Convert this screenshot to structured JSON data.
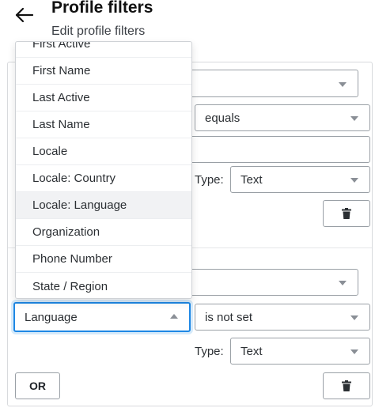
{
  "header": {
    "title": "Profile filters",
    "subtitle": "Edit profile filters"
  },
  "filter1": {
    "operator_value": "equals",
    "type_label": "Type:",
    "type_value": "Text"
  },
  "filter2": {
    "field_value": "Language",
    "operator_value": "is not set",
    "type_label": "Type:",
    "type_value": "Text"
  },
  "or_button_label": "OR",
  "dropdown": {
    "items": [
      "First Active",
      "First Name",
      "Last Active",
      "Last Name",
      "Locale",
      "Locale: Country",
      "Locale: Language",
      "Organization",
      "Phone Number",
      "State / Region"
    ],
    "highlighted": "Locale: Language"
  },
  "colors": {
    "focus_border": "#1e88e5",
    "highlight_bg": "#f1f2f4"
  },
  "icons": [
    "back-arrow-icon",
    "chevron-down-icon",
    "chevron-up-icon",
    "trash-icon"
  ]
}
